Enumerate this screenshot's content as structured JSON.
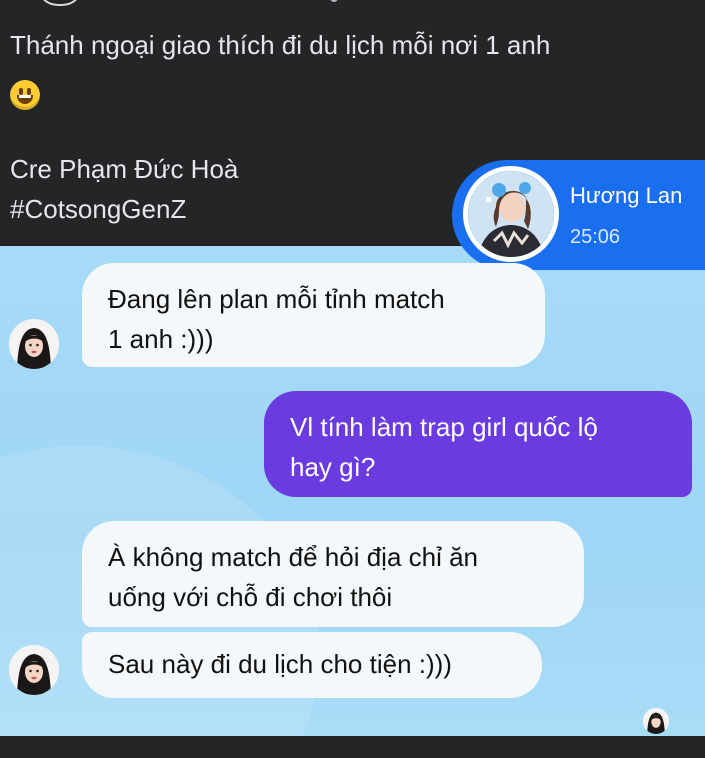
{
  "post": {
    "caption": "Thánh ngoại giao thích đi du lịch mỗi nơi 1 anh",
    "emoji_icon": "grinning-face-emoji",
    "credit": "Cre Phạm Đức Hoà",
    "hashtag": "#CotsongGenZ"
  },
  "chat": {
    "contact": {
      "name": "Hương Lan",
      "time": "25:06"
    },
    "messages": [
      {
        "direction": "incoming",
        "lines": [
          "Đang lên plan mỗi tỉnh match",
          "1 anh :)))"
        ]
      },
      {
        "direction": "outgoing",
        "lines": [
          "Vl tính làm trap girl quốc lộ",
          "hay gì?"
        ]
      },
      {
        "direction": "incoming",
        "lines": [
          "À không match để hỏi địa chỉ ăn",
          "uống với chỗ đi chơi thôi"
        ]
      },
      {
        "direction": "incoming",
        "lines": [
          "Sau này đi du lịch cho tiện :)))"
        ]
      }
    ]
  },
  "colors": {
    "page_background": "#242526",
    "chat_background": "#a6dbf8",
    "incoming_bubble": "#f4f8fb",
    "outgoing_bubble": "#6a3ce0",
    "contact_card": "#1a6ff0"
  }
}
